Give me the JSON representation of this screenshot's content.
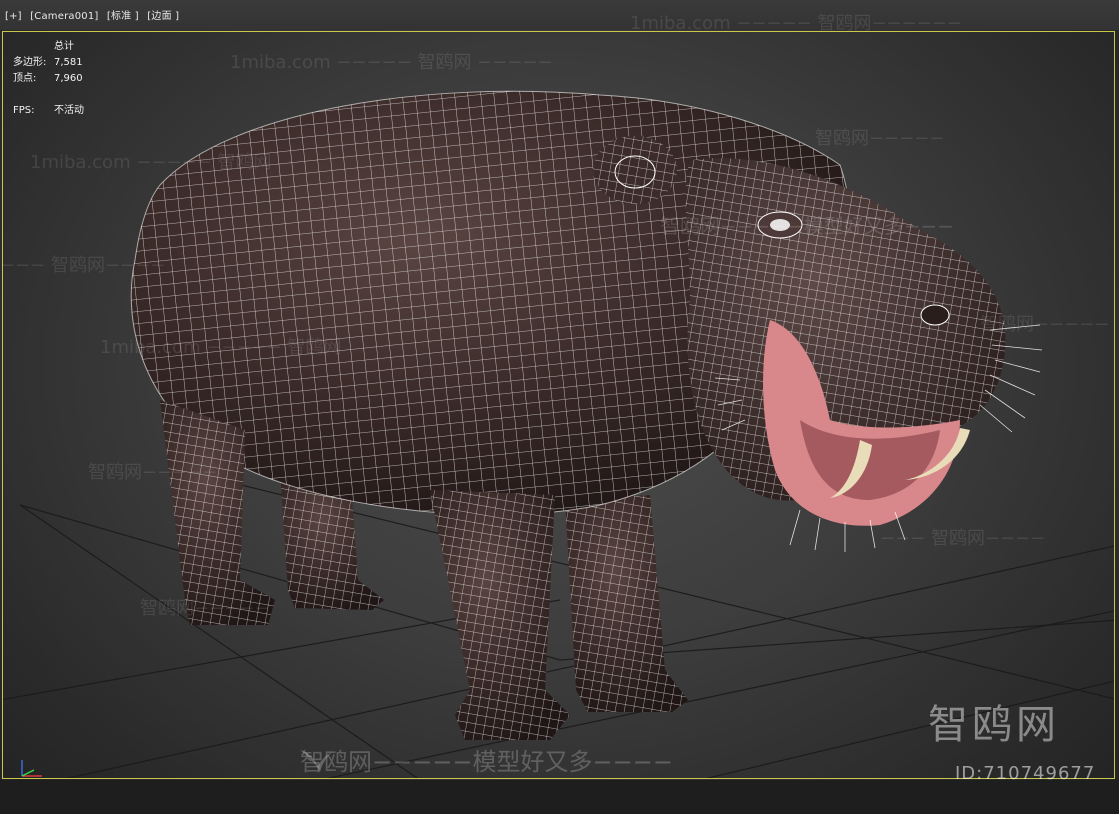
{
  "viewport": {
    "menu": [
      "[+]",
      "[Camera001]",
      "[标准 ]",
      "[边面 ]"
    ]
  },
  "stats": {
    "header": "总计",
    "polygons_label": "多边形:",
    "polygons_value": "7,581",
    "vertices_label": "顶点:",
    "vertices_value": "7,960",
    "fps_label": "FPS:",
    "fps_value": "不活动"
  },
  "watermarks": {
    "site": "1miba.com −−−−− 智鸥网−−−−−−",
    "repeat_a": "1miba.com −−−−− 智鸥网 −−−−−",
    "repeat_b": "智鸥网−−−−−",
    "repeat_c": "−−− 智鸥网−−−−",
    "repeat_d": "1miba.com −−−−− 智鸥网",
    "mid": "智鸥网−−−−−模型好又多−−−",
    "bottom": "智鸥网−−−−−模型好又多−−−−",
    "logo": "智鸥网",
    "id": "ID:710749677"
  },
  "colors": {
    "frame_accent": "#c9c84a",
    "hippo_skin": "#3a2a28",
    "wire": "#ffffff",
    "mouth": "#d8878a"
  },
  "icons": {
    "axis": "axis-gizmo-icon",
    "bird": "bird-logo-icon"
  }
}
